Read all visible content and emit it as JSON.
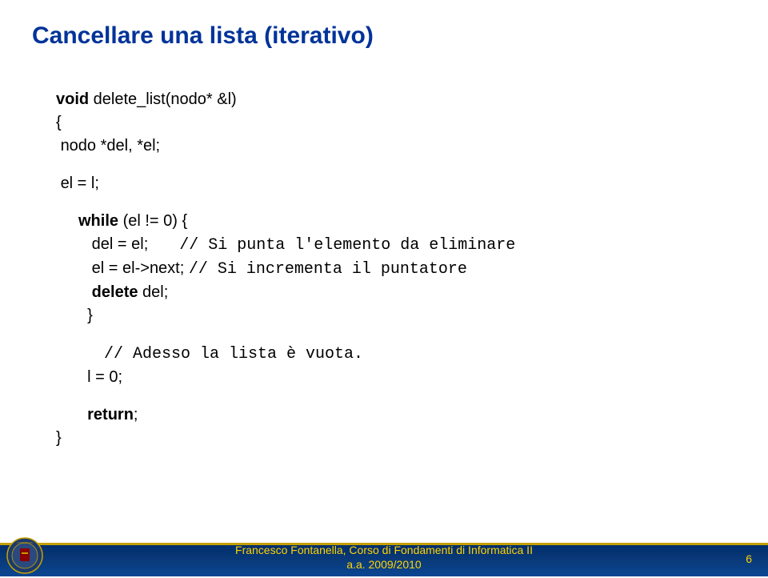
{
  "title": "Cancellare una lista (iterativo)",
  "code": {
    "line1_kw": "void",
    "line1_rest": " delete_list(nodo* &l)",
    "line2": "{",
    "line3": " nodo *del, *el;",
    "line4": " el = l;",
    "line5_kw": "while",
    "line5_rest": " (el != 0) {",
    "line6_lhs": "   del = el;       ",
    "line6_comment": "// Si punta l'elemento da eliminare",
    "line7_lhs": "   el = el->next; ",
    "line7_comment": "// Si incrementa il puntatore",
    "line8_kw": "delete",
    "line8_rest": " del;",
    "line9": "}",
    "line10_comment": "// Adesso la lista è vuota.",
    "line11": "l = 0;",
    "line12_kw": "return",
    "line12_rest": ";",
    "line13": "}"
  },
  "footer": {
    "line1": "Francesco Fontanella, Corso di Fondamenti di Informatica II",
    "line2": "a.a. 2009/2010",
    "page": "6"
  }
}
